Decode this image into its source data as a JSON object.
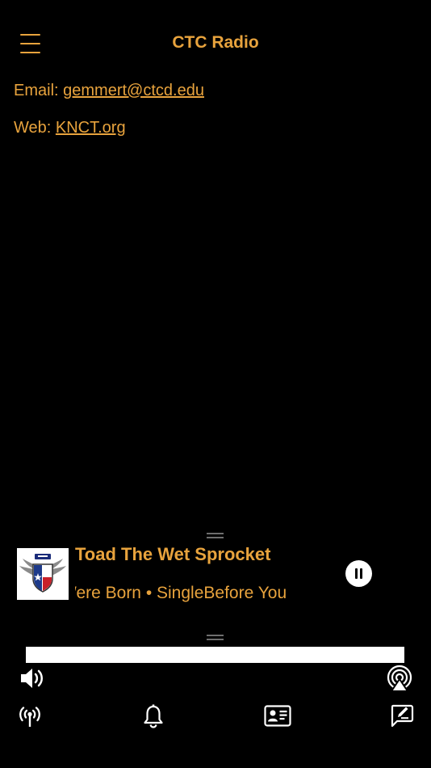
{
  "header": {
    "title": "CTC Radio",
    "menu_icon": "hamburger-menu-icon"
  },
  "contact": {
    "email_label": "Email:",
    "email_value": "gemmert@ctcd.edu",
    "web_label": "Web:",
    "web_value": "KNCT.org"
  },
  "now_playing": {
    "artist": "Toad The Wet Sprocket",
    "subtitle": "Were Born • SingleBefore You",
    "album_art_icon": "station-logo-icon",
    "state": "playing"
  },
  "progress": {
    "fraction": 1.0
  },
  "colors": {
    "accent": "#e8a33d",
    "background": "#000000"
  },
  "controls": {
    "volume_icon": "speaker-volume-icon",
    "airplay_icon": "airplay-icon"
  },
  "tabbar": {
    "items": [
      {
        "icon": "broadcast-tower-icon"
      },
      {
        "icon": "bell-icon"
      },
      {
        "icon": "contact-card-icon"
      },
      {
        "icon": "edit-message-icon"
      }
    ]
  }
}
